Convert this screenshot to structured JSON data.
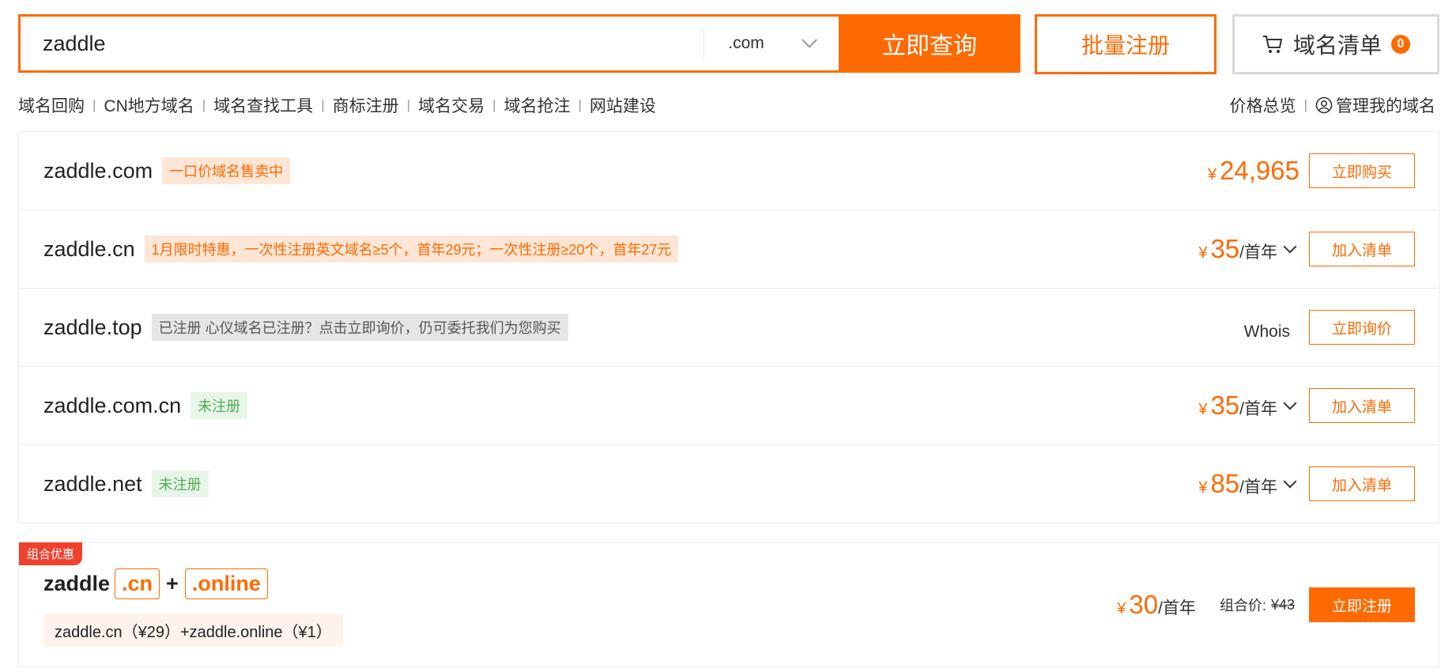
{
  "search": {
    "query": "zaddle",
    "suffix": ".com",
    "button": "立即查询",
    "bulk_label": "批量注册",
    "cart_label": "域名清单",
    "cart_count": "0"
  },
  "nav_links": [
    "域名回购",
    "CN地方域名",
    "域名查找工具",
    "商标注册",
    "域名交易",
    "域名抢注",
    "网站建设"
  ],
  "right_links": {
    "price_overview": "价格总览",
    "manage": "管理我的域名"
  },
  "results": [
    {
      "domain": "zaddle.com",
      "tag": "一口价域名售卖中",
      "tag_color": "#ff6a00",
      "currency": "¥",
      "price": "24,965",
      "unit": "",
      "action": "立即购买"
    },
    {
      "domain": "zaddle.cn",
      "tag": "1月限时特惠，一次性注册英文域名≥5个，首年29元；一次性注册≥20个，首年27元",
      "tag_color": "#ff6a00",
      "currency": "¥",
      "price": "35",
      "unit": "/首年",
      "action": "加入清单"
    },
    {
      "domain": "zaddle.top",
      "tag": "已注册 心仪域名已注册？点击立即询价，仍可委托我们为您购买",
      "tag_color": "#555555",
      "whois": "Whois",
      "action": "立即询价"
    },
    {
      "domain": "zaddle.com.cn",
      "tag": "未注册",
      "tag_color": "#4caf50",
      "currency": "¥",
      "price": "35",
      "unit": "/首年",
      "action": "加入清单"
    },
    {
      "domain": "zaddle.net",
      "tag": "未注册",
      "tag_color": "#4caf50",
      "currency": "¥",
      "price": "85",
      "unit": "/首年",
      "action": "加入清单"
    }
  ],
  "combo": {
    "badge": "组合优惠",
    "name": "zaddle",
    "ext1": ".cn",
    "plus": "+",
    "ext2": ".online",
    "detail": "zaddle.cn（¥29）+zaddle.online（¥1）",
    "currency": "¥",
    "price": "30",
    "unit": "/首年",
    "combo_label": "组合价:",
    "original_price": "¥43",
    "action": "立即注册"
  },
  "colors": {
    "accent": "#ff6a00",
    "badge_red": "#f0412f"
  }
}
